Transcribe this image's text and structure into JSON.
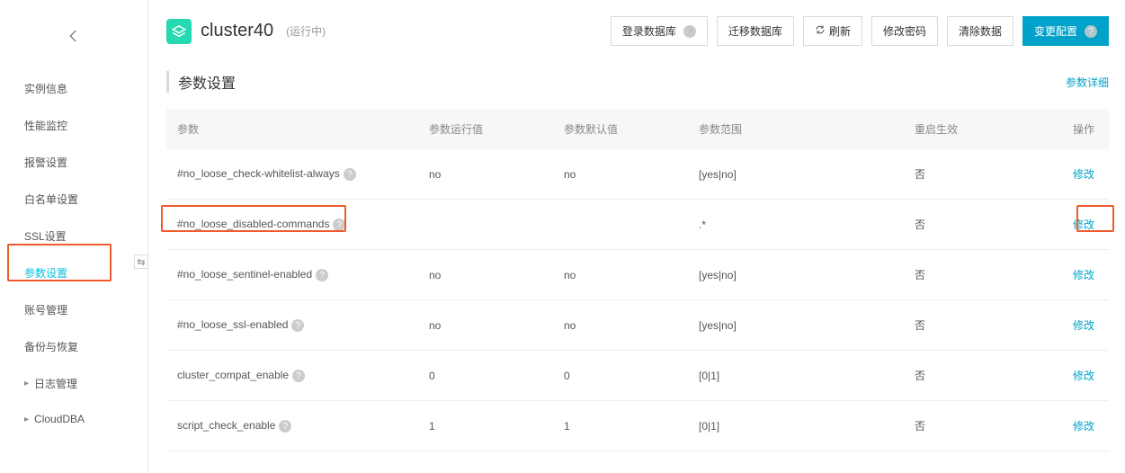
{
  "sidebar": {
    "items": [
      {
        "label": "实例信息"
      },
      {
        "label": "性能监控"
      },
      {
        "label": "报警设置"
      },
      {
        "label": "白名单设置"
      },
      {
        "label": "SSL设置"
      },
      {
        "label": "参数设置"
      },
      {
        "label": "账号管理"
      },
      {
        "label": "备份与恢复"
      },
      {
        "label": "日志管理"
      },
      {
        "label": "CloudDBA"
      }
    ]
  },
  "header": {
    "title": "cluster40",
    "state": "(运行中)",
    "buttons": {
      "login_db": "登录数据库",
      "migrate_db": "迁移数据库",
      "refresh": "刷新",
      "change_pwd": "修改密码",
      "clear_data": "清除数据",
      "change_config": "变更配置"
    }
  },
  "section": {
    "title": "参数设置",
    "detail_link": "参数详细"
  },
  "table": {
    "cols": {
      "name": "参数",
      "run": "参数运行值",
      "default": "参数默认值",
      "range": "参数范围",
      "restart": "重启生效",
      "op": "操作"
    },
    "rows": [
      {
        "name": "#no_loose_check-whitelist-always",
        "run": "no",
        "def": "no",
        "range": "[yes|no]",
        "restart": "否",
        "op": "修改"
      },
      {
        "name": "#no_loose_disabled-commands",
        "run": "",
        "def": "",
        "range": ".*",
        "restart": "否",
        "op": "修改"
      },
      {
        "name": "#no_loose_sentinel-enabled",
        "run": "no",
        "def": "no",
        "range": "[yes|no]",
        "restart": "否",
        "op": "修改"
      },
      {
        "name": "#no_loose_ssl-enabled",
        "run": "no",
        "def": "no",
        "range": "[yes|no]",
        "restart": "否",
        "op": "修改"
      },
      {
        "name": "cluster_compat_enable",
        "run": "0",
        "def": "0",
        "range": "[0|1]",
        "restart": "否",
        "op": "修改"
      },
      {
        "name": "script_check_enable",
        "run": "1",
        "def": "1",
        "range": "[0|1]",
        "restart": "否",
        "op": "修改"
      }
    ]
  }
}
